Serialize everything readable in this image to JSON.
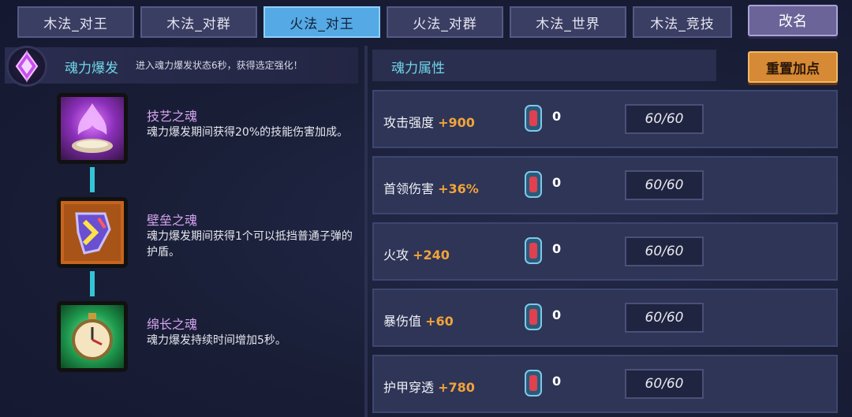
{
  "tabs": [
    {
      "label": "木法_对王",
      "active": false
    },
    {
      "label": "木法_对群",
      "active": false
    },
    {
      "label": "火法_对王",
      "active": true
    },
    {
      "label": "火法_对群",
      "active": false
    },
    {
      "label": "木法_世界",
      "active": false
    },
    {
      "label": "木法_竞技",
      "active": false
    }
  ],
  "rename_label": "改名",
  "reset_label": "重置加点",
  "burst": {
    "title": "魂力爆发",
    "description": "进入魂力爆发状态6秒，获得选定强化！"
  },
  "souls": [
    {
      "name": "技艺之魂",
      "description": "魂力爆发期间获得20%的技能伤害加成。",
      "icon": "purple-flame-icon"
    },
    {
      "name": "壁垒之魂",
      "description": "魂力爆发期间获得1个可以抵挡普通子弹的护盾。",
      "icon": "shield-icon"
    },
    {
      "name": "绵长之魂",
      "description": "魂力爆发持续时间增加5秒。",
      "icon": "stopwatch-icon"
    }
  ],
  "attributes": {
    "title": "魂力属性",
    "rows": [
      {
        "label": "攻击强度",
        "bonus": "+900",
        "gem_count": "0",
        "cap": "60/60"
      },
      {
        "label": "首领伤害",
        "bonus": "+36%",
        "gem_count": "0",
        "cap": "60/60"
      },
      {
        "label": "火攻",
        "bonus": "+240",
        "gem_count": "0",
        "cap": "60/60"
      },
      {
        "label": "暴伤值",
        "bonus": "+60",
        "gem_count": "0",
        "cap": "60/60"
      },
      {
        "label": "护甲穿透",
        "bonus": "+780",
        "gem_count": "0",
        "cap": "60/60"
      }
    ]
  },
  "colors": {
    "accent_cyan": "#6fd6e8",
    "bonus_orange": "#f2a33a",
    "active_tab": "#55a9e4"
  }
}
